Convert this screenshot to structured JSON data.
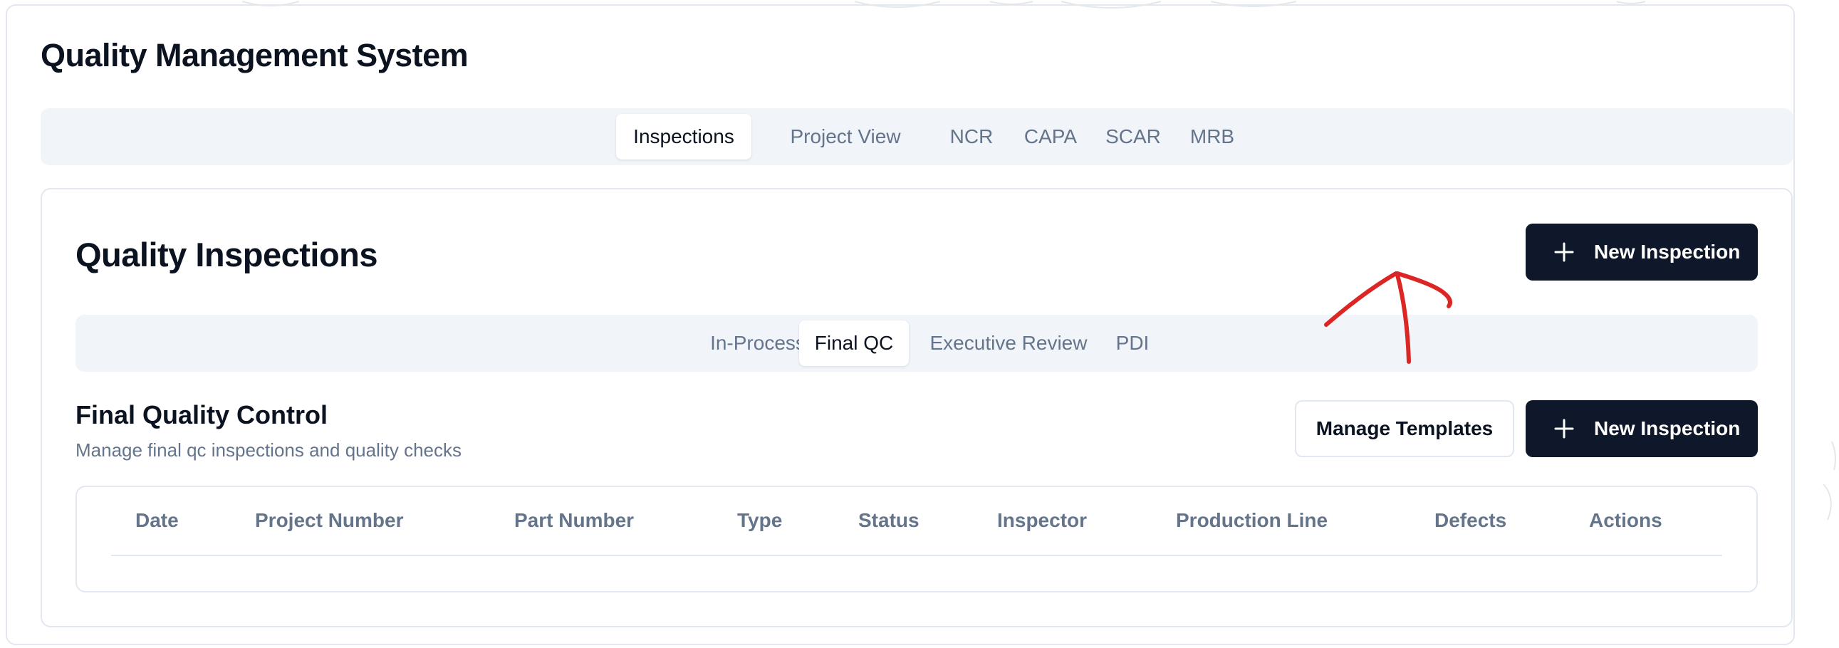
{
  "app": {
    "title": "Quality Management System"
  },
  "main_tabs": [
    {
      "label": "Inspections",
      "active": true
    },
    {
      "label": "Project View",
      "active": false
    },
    {
      "label": "NCR",
      "active": false
    },
    {
      "label": "CAPA",
      "active": false
    },
    {
      "label": "SCAR",
      "active": false
    },
    {
      "label": "MRB",
      "active": false
    }
  ],
  "card": {
    "title": "Quality Inspections",
    "new_inspection_label": "New Inspection"
  },
  "sub_tabs": [
    {
      "label": "In-Process",
      "active": false
    },
    {
      "label": "Final QC",
      "active": true
    },
    {
      "label": "Executive Review",
      "active": false
    },
    {
      "label": "PDI",
      "active": false
    }
  ],
  "section": {
    "title": "Final Quality Control",
    "subtitle": "Manage final qc inspections and quality checks",
    "manage_templates_label": "Manage Templates",
    "new_inspection_label": "New Inspection"
  },
  "table": {
    "columns": [
      "Date",
      "Project Number",
      "Part Number",
      "Type",
      "Status",
      "Inspector",
      "Production Line",
      "Defects",
      "Actions"
    ],
    "rows": []
  },
  "icons": {
    "new_inspection": "plus-icon"
  },
  "colors": {
    "primary_button": "#0f172a",
    "tab_bar": "#f1f5f9",
    "muted_text": "#64748b",
    "annotation_stroke": "#dc2626"
  }
}
